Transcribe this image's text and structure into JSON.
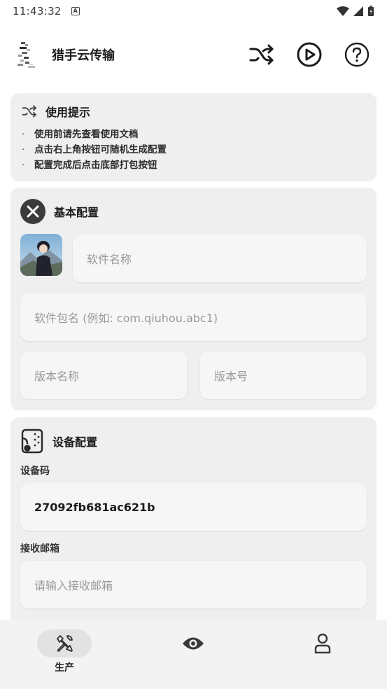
{
  "status_bar": {
    "time": "11:43:32",
    "notification_icon": "A"
  },
  "app_bar": {
    "title": "猎手云传输",
    "actions": [
      "shuffle-icon",
      "play-circle-icon",
      "help-circle-icon"
    ]
  },
  "tips": {
    "title": "使用提示",
    "items": [
      "使用前请先查看使用文档",
      "点击右上角按钮可随机生成配置",
      "配置完成后点击底部打包按钮"
    ]
  },
  "basic_config": {
    "title": "基本配置",
    "app_name_placeholder": "软件名称",
    "package_placeholder": "软件包名 (例如: com.qiuhou.abc1)",
    "version_name_placeholder": "版本名称",
    "version_code_placeholder": "版本号"
  },
  "device_config": {
    "title": "设备配置",
    "device_code_label": "设备码",
    "device_code_value": "27092fb681ac621b",
    "email_label": "接收邮箱",
    "email_placeholder": "请输入接收邮箱"
  },
  "bottom_nav": {
    "items": [
      {
        "label": "生产",
        "icon": "tools-icon",
        "active": true
      },
      {
        "label": "",
        "icon": "eye-icon",
        "active": false
      },
      {
        "label": "",
        "icon": "person-icon",
        "active": false
      }
    ]
  },
  "colors": {
    "card_bg": "#efefef",
    "field_bg": "#f6f6f6",
    "nav_bg": "#f3f3f3",
    "text": "#1c1c1c",
    "placeholder": "#9a9a9a"
  }
}
